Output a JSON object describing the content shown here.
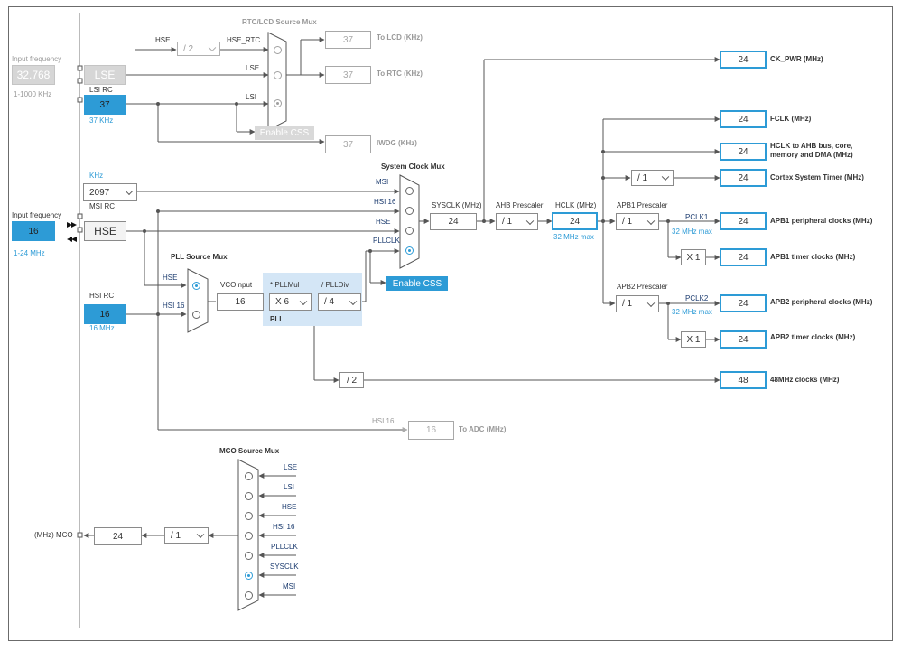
{
  "lse": {
    "freq_title": "Input frequency",
    "freq_value": "32.768",
    "freq_range": "1-1000 KHz",
    "label": "LSE"
  },
  "lsi": {
    "title": "LSI RC",
    "value": "37",
    "unit": "37 KHz"
  },
  "rtc": {
    "mux_title": "RTC/LCD Source Mux",
    "hse_label": "HSE",
    "hse_div": "/ 2",
    "hse_rtc": "HSE_RTC",
    "lse_label": "LSE",
    "lsi_label": "LSI",
    "enable_css": "Enable CSS",
    "lcd_value": "37",
    "lcd_label": "To LCD (KHz)",
    "rtc_value": "37",
    "rtc_label": "To RTC (KHz)",
    "iwdg_value": "37",
    "iwdg_label": "IWDG (KHz)"
  },
  "msi": {
    "unit": "KHz",
    "value": "2097",
    "title": "MSI RC"
  },
  "hse": {
    "freq_title": "Input frequency",
    "freq_value": "16",
    "freq_range": "1-24 MHz",
    "label": "HSE"
  },
  "hsi": {
    "title": "HSI RC",
    "value": "16",
    "unit": "16 MHz"
  },
  "pll": {
    "mux_title": "PLL Source Mux",
    "hse_label": "HSE",
    "hsi_label": "HSI 16",
    "vco_label": "VCOInput",
    "vco_value": "16",
    "mul_label": "* PLLMul",
    "mul_value": "X 6",
    "div_label": "/ PLLDiv",
    "div_value": "/ 4",
    "block_label": "PLL"
  },
  "sysmux": {
    "title": "System Clock Mux",
    "msi": "MSI",
    "hsi": "HSI 16",
    "hse": "HSE",
    "pllclk": "PLLCLK",
    "enable_css": "Enable CSS"
  },
  "sysclk": {
    "label": "SYSCLK (MHz)",
    "value": "24"
  },
  "ahb": {
    "label": "AHB Prescaler",
    "value": "/ 1"
  },
  "hclk": {
    "label": "HCLK (MHz)",
    "value": "24",
    "max": "32 MHz max"
  },
  "apb1": {
    "label": "APB1 Prescaler",
    "value": "/ 1",
    "pclk": "PCLK1",
    "max": "32 MHz max",
    "timer_mul": "X 1"
  },
  "apb2": {
    "label": "APB2 Prescaler",
    "value": "/ 1",
    "pclk": "PCLK2",
    "max": "32 MHz max",
    "timer_mul": "X 1"
  },
  "cortex_div": "/ 1",
  "usb_div": "/ 2",
  "outputs": {
    "ck_pwr": {
      "value": "24",
      "label": "CK_PWR (MHz)"
    },
    "fclk": {
      "value": "24",
      "label": "FCLK (MHz)"
    },
    "hclk_ahb": {
      "value": "24",
      "label1": "HCLK to AHB bus, core,",
      "label2": "memory and DMA (MHz)"
    },
    "cortex": {
      "value": "24",
      "label": "Cortex System Timer (MHz)"
    },
    "apb1_periph": {
      "value": "24",
      "label": "APB1 peripheral clocks (MHz)"
    },
    "apb1_timer": {
      "value": "24",
      "label": "APB1 timer clocks (MHz)"
    },
    "apb2_periph": {
      "value": "24",
      "label": "APB2 peripheral clocks (MHz)"
    },
    "apb2_timer": {
      "value": "24",
      "label": "APB2 timer clocks (MHz)"
    },
    "clk48": {
      "value": "48",
      "label": "48MHz clocks (MHz)"
    },
    "adc": {
      "value": "16",
      "label": "To ADC (MHz)",
      "src": "HSI 16"
    }
  },
  "mco": {
    "mux_title": "MCO Source Mux",
    "sources": [
      "LSE",
      "LSI",
      "HSE",
      "HSI 16",
      "PLLCLK",
      "SYSCLK",
      "MSI"
    ],
    "div": "/ 1",
    "value": "24",
    "label": "(MHz) MCO"
  },
  "colors": {
    "accent": "#2d9bd6",
    "pll_block": "#d4e6f6",
    "wire": "#555555",
    "disabled": "#a8a8a8"
  }
}
